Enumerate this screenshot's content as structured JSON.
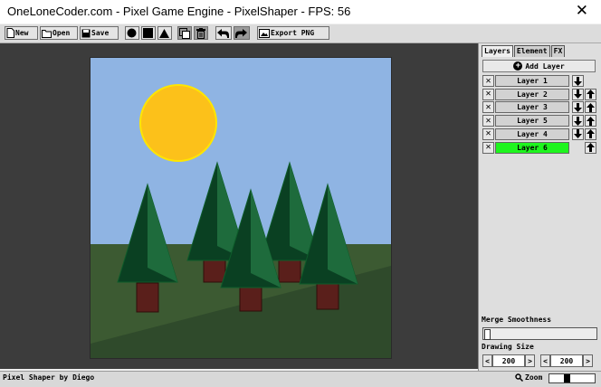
{
  "window": {
    "title": "OneLoneCoder.com - Pixel Game Engine - PixelShaper - FPS: 56",
    "close_label": "✕"
  },
  "toolbar": {
    "new_label": "New",
    "open_label": "Open",
    "save_label": "Save",
    "export_label": "Export PNG",
    "tools": [
      "circle-tool",
      "square-tool",
      "triangle-tool",
      "duplicate-tool",
      "delete-tool",
      "undo-tool",
      "redo-tool"
    ]
  },
  "panel": {
    "tabs": [
      {
        "label": "Layers",
        "active": true
      },
      {
        "label": "Element",
        "active": false
      },
      {
        "label": "FX",
        "active": false
      }
    ],
    "add_layer_label": "Add Layer",
    "add_icon": "+",
    "delete_icon": "✕",
    "layers": [
      {
        "name": "Layer 1",
        "down": true,
        "up": false,
        "selected": false
      },
      {
        "name": "Layer 2",
        "down": true,
        "up": true,
        "selected": false
      },
      {
        "name": "Layer 3",
        "down": true,
        "up": true,
        "selected": false
      },
      {
        "name": "Layer 5",
        "down": true,
        "up": true,
        "selected": false
      },
      {
        "name": "Layer 4",
        "down": true,
        "up": true,
        "selected": false
      },
      {
        "name": "Layer 6",
        "down": false,
        "up": true,
        "selected": true
      }
    ],
    "merge_label": "Merge Smoothness",
    "merge_value": 0,
    "drawing_size_label": "Drawing Size",
    "size": {
      "width": "200",
      "height": "200",
      "dec": "<",
      "inc": ">"
    }
  },
  "status": {
    "left": "Pixel Shaper by Diego",
    "zoom_label": "Zoom",
    "zoom_value": 0.4
  },
  "colors": {
    "sky": "#8fb4e3",
    "ground": "#3c5a32",
    "ground_shadow": "#2f4a2b",
    "sun": "#fcc11a",
    "tree_dark": "#0a4022",
    "tree_light": "#1e6b3c",
    "trunk": "#5a1f1b",
    "selected_layer": "#1ef51e"
  }
}
